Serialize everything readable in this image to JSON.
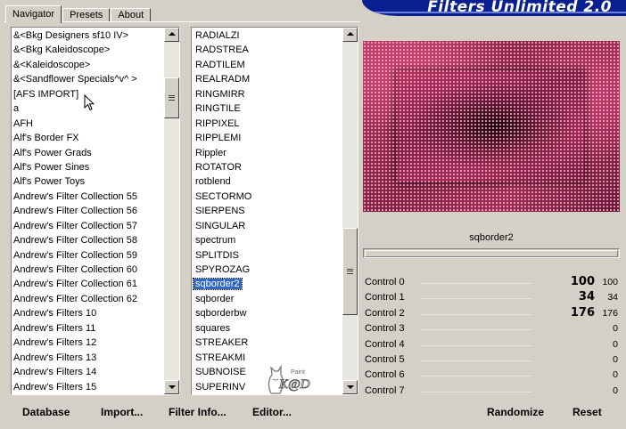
{
  "app": {
    "title": "Filters Unlimited 2.0"
  },
  "tabs": [
    {
      "label": "Navigator",
      "active": true
    },
    {
      "label": "Presets",
      "active": false
    },
    {
      "label": "About",
      "active": false
    }
  ],
  "categories": {
    "items": [
      "&<Bkg Designers sf10 IV>",
      "&<Bkg Kaleidoscope>",
      "&<Kaleidoscope>",
      "&<Sandflower Specials^v^ >",
      "[AFS IMPORT]",
      "a",
      "AFH",
      "Alf's Border FX",
      "Alf's Power Grads",
      "Alf's Power Sines",
      "Alf's Power Toys",
      "Andrew's Filter Collection 55",
      "Andrew's Filter Collection 56",
      "Andrew's Filter Collection 57",
      "Andrew's Filter Collection 58",
      "Andrew's Filter Collection 59",
      "Andrew's Filter Collection 60",
      "Andrew's Filter Collection 61",
      "Andrew's Filter Collection 62",
      "Andrew's Filters 10",
      "Andrew's Filters 11",
      "Andrew's Filters 12",
      "Andrew's Filters 13",
      "Andrew's Filters 14",
      "Andrew's Filters 15"
    ],
    "scroll_position": 0.12
  },
  "filters": {
    "items": [
      "RADIALZI",
      "RADSTREA",
      "RADTILEM",
      "REALRADM",
      "RINGMIRR",
      "RINGTILE",
      "RIPPIXEL",
      "RIPPLEMI",
      "Rippler",
      "ROTATOR",
      "rotblend",
      "SECTORMO",
      "SIERPENS",
      "SINGULAR",
      "spectrum",
      "SPLITDIS",
      "SPYROZAG",
      "sqborder2",
      "sqborder",
      "sqborderbw",
      "squares",
      "STREAKER",
      "STREAKMI",
      "SUBNOISE",
      "SUPERINV"
    ],
    "selected": "sqborder2",
    "scroll_position": 0.74
  },
  "preview": {
    "filter_name": "sqborder2"
  },
  "controls": [
    {
      "label": "Control 0",
      "display": "100",
      "value": "100"
    },
    {
      "label": "Control 1",
      "display": "34",
      "value": "34"
    },
    {
      "label": "Control 2",
      "display": "176",
      "value": "176"
    },
    {
      "label": "Control 3",
      "display": "",
      "value": "0"
    },
    {
      "label": "Control 4",
      "display": "",
      "value": "0"
    },
    {
      "label": "Control 5",
      "display": "",
      "value": "0"
    },
    {
      "label": "Control 6",
      "display": "",
      "value": "0"
    },
    {
      "label": "Control 7",
      "display": "",
      "value": "0"
    }
  ],
  "buttons": {
    "database": "Database",
    "import": "Import...",
    "filter_info": "Filter Info...",
    "editor": "Editor...",
    "randomize": "Randomize",
    "reset": "Reset"
  },
  "icons": {
    "cursor": "arrow-cursor-icon",
    "logo": "cat-logo-icon"
  },
  "logo": {
    "small": "Paint",
    "text": "K@D"
  }
}
